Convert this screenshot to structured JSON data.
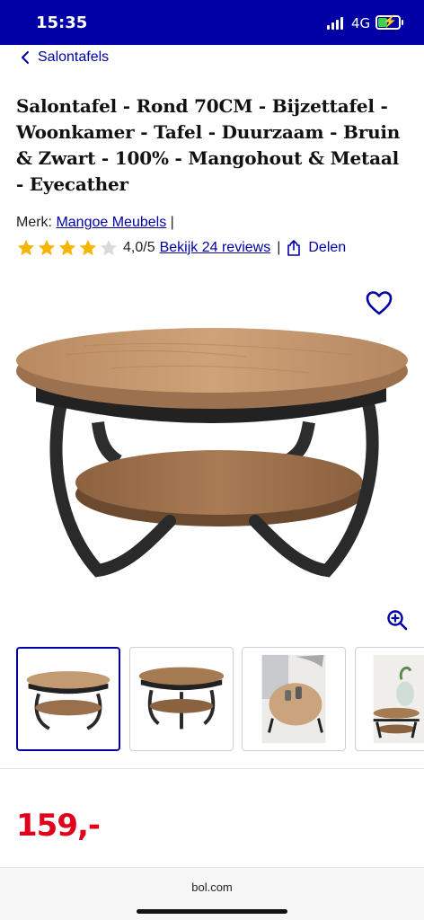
{
  "status": {
    "time": "15:35",
    "network": "4G"
  },
  "nav": {
    "back_label": "Salontafels"
  },
  "product": {
    "title": "Salontafel - Rond 70CM - Bijzettafel - Woonkamer - Tafel - Duurzaam - Bruin & Zwart - 100% - Mangohout & Metaal - Eyecather",
    "brand_prefix": "Merk:",
    "brand": "Mangoe Meubels",
    "brand_sep": "|",
    "rating": 4.0,
    "rating_max": 5,
    "rating_text": "4,0/5",
    "reviews_link": "Bekijk 24 reviews",
    "share_sep": "|",
    "share_label": "Delen",
    "price": "159,-",
    "thumbnails": [
      "table-front",
      "table-angle",
      "table-lifestyle",
      "table-lifestyle-plant"
    ]
  },
  "colors": {
    "brand_blue": "#0000a4",
    "price_red": "#e0001b",
    "star_yellow": "#f7b500",
    "star_empty": "#d9d9d9"
  },
  "browser": {
    "url": "bol.com"
  }
}
